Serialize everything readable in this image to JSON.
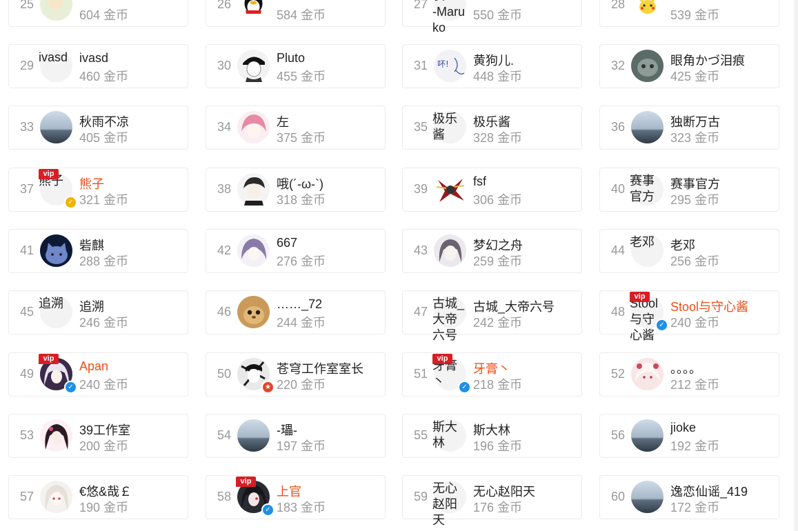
{
  "coin_unit": "金币",
  "cards": [
    {
      "rank": "25",
      "name": "",
      "coins": "604",
      "avatar": "anime-green"
    },
    {
      "rank": "26",
      "name": "",
      "coins": "584",
      "avatar": "qq-penguin"
    },
    {
      "rank": "27",
      "name": "",
      "coins": "550",
      "avatar": "text",
      "avatar_text": "长\n-Maruko"
    },
    {
      "rank": "28",
      "name": "",
      "coins": "539",
      "avatar": "pikachu"
    },
    {
      "rank": "29",
      "name": "ivasd",
      "coins": "460",
      "avatar": "text",
      "avatar_text": "ivasd"
    },
    {
      "rank": "30",
      "name": "Pluto",
      "coins": "455",
      "avatar": "sketch-boy"
    },
    {
      "rank": "31",
      "name": "黄狗儿.",
      "coins": "448",
      "avatar": "doodle"
    },
    {
      "rank": "32",
      "name": "眼角かづ泪痕",
      "coins": "425",
      "avatar": "gray-cat"
    },
    {
      "rank": "33",
      "name": "秋雨不凉",
      "coins": "405",
      "avatar": "sea"
    },
    {
      "rank": "34",
      "name": "左",
      "coins": "375",
      "avatar": "pink-hair"
    },
    {
      "rank": "35",
      "name": "极乐酱",
      "coins": "328",
      "avatar": "text",
      "avatar_text": "极乐\n酱"
    },
    {
      "rank": "36",
      "name": "独断万古",
      "coins": "323",
      "avatar": "sea"
    },
    {
      "rank": "37",
      "name": "熊子",
      "coins": "321",
      "avatar": "text",
      "avatar_text": "熊子",
      "vip": true,
      "badge": "gold"
    },
    {
      "rank": "38",
      "name": "哦(´-ω-`)",
      "coins": "318",
      "avatar": "dark-boy"
    },
    {
      "rank": "39",
      "name": "fsf",
      "coins": "306",
      "avatar": "red-robot"
    },
    {
      "rank": "40",
      "name": "赛事官方",
      "coins": "295",
      "avatar": "text",
      "avatar_text": "赛事\n官方"
    },
    {
      "rank": "41",
      "name": "砦麒",
      "coins": "288",
      "avatar": "blue-cat"
    },
    {
      "rank": "42",
      "name": "667",
      "coins": "276",
      "avatar": "purple-girl"
    },
    {
      "rank": "43",
      "name": "梦幻之舟",
      "coins": "259",
      "avatar": "gray-girl"
    },
    {
      "rank": "44",
      "name": "老邓",
      "coins": "256",
      "avatar": "text",
      "avatar_text": "老邓"
    },
    {
      "rank": "45",
      "name": "追溯",
      "coins": "246",
      "avatar": "text",
      "avatar_text": "追溯"
    },
    {
      "rank": "46",
      "name": "……_72",
      "coins": "244",
      "avatar": "orange-cat"
    },
    {
      "rank": "47",
      "name": "古城_大帝六号",
      "coins": "242",
      "avatar": "text",
      "avatar_text": "古城_\n大帝\n六号"
    },
    {
      "rank": "48",
      "name": "Stool与守心酱",
      "coins": "240",
      "avatar": "text",
      "avatar_text": "Stool\n与守\n心酱",
      "vip": true,
      "badge": "blue"
    },
    {
      "rank": "49",
      "name": "Apan",
      "coins": "240",
      "avatar": "white-hair",
      "vip": true,
      "badge": "blue"
    },
    {
      "rank": "50",
      "name": "苍穹工作室室长",
      "coins": "220",
      "avatar": "bw-anime",
      "badge": "red"
    },
    {
      "rank": "51",
      "name": "牙膏丶",
      "coins": "218",
      "avatar": "text",
      "avatar_text": "牙膏\n丶",
      "vip": true,
      "badge": "blue"
    },
    {
      "rank": "52",
      "name": "。。。。",
      "coins": "212",
      "avatar": "pink-anime"
    },
    {
      "rank": "53",
      "name": "39工作室",
      "coins": "200",
      "avatar": "pink-girl"
    },
    {
      "rank": "54",
      "name": "-瓃-",
      "coins": "197",
      "avatar": "sea"
    },
    {
      "rank": "55",
      "name": "斯大林",
      "coins": "196",
      "avatar": "text",
      "avatar_text": "斯大\n林"
    },
    {
      "rank": "56",
      "name": "jioke",
      "coins": "192",
      "avatar": "sea"
    },
    {
      "rank": "57",
      "name": "€悠&哉￡",
      "coins": "190",
      "avatar": "white-girl"
    },
    {
      "rank": "58",
      "name": "上官",
      "coins": "183",
      "avatar": "dark-anime",
      "vip": true,
      "badge": "blue"
    },
    {
      "rank": "59",
      "name": "无心赵阳天",
      "coins": "176",
      "avatar": "text",
      "avatar_text": "无心\n赵阳\n天"
    },
    {
      "rank": "60",
      "name": "逸恋仙谣_419",
      "coins": "172",
      "avatar": "sea"
    }
  ],
  "colors": {
    "vip_name": "#f04d15",
    "vip_badge": "#d81e24",
    "verified_blue": "#1e90e6",
    "verified_gold": "#f0b400",
    "verified_red": "#e2462a"
  },
  "badge_text": {
    "vip": "vip",
    "verified": "✓",
    "official": "★"
  }
}
